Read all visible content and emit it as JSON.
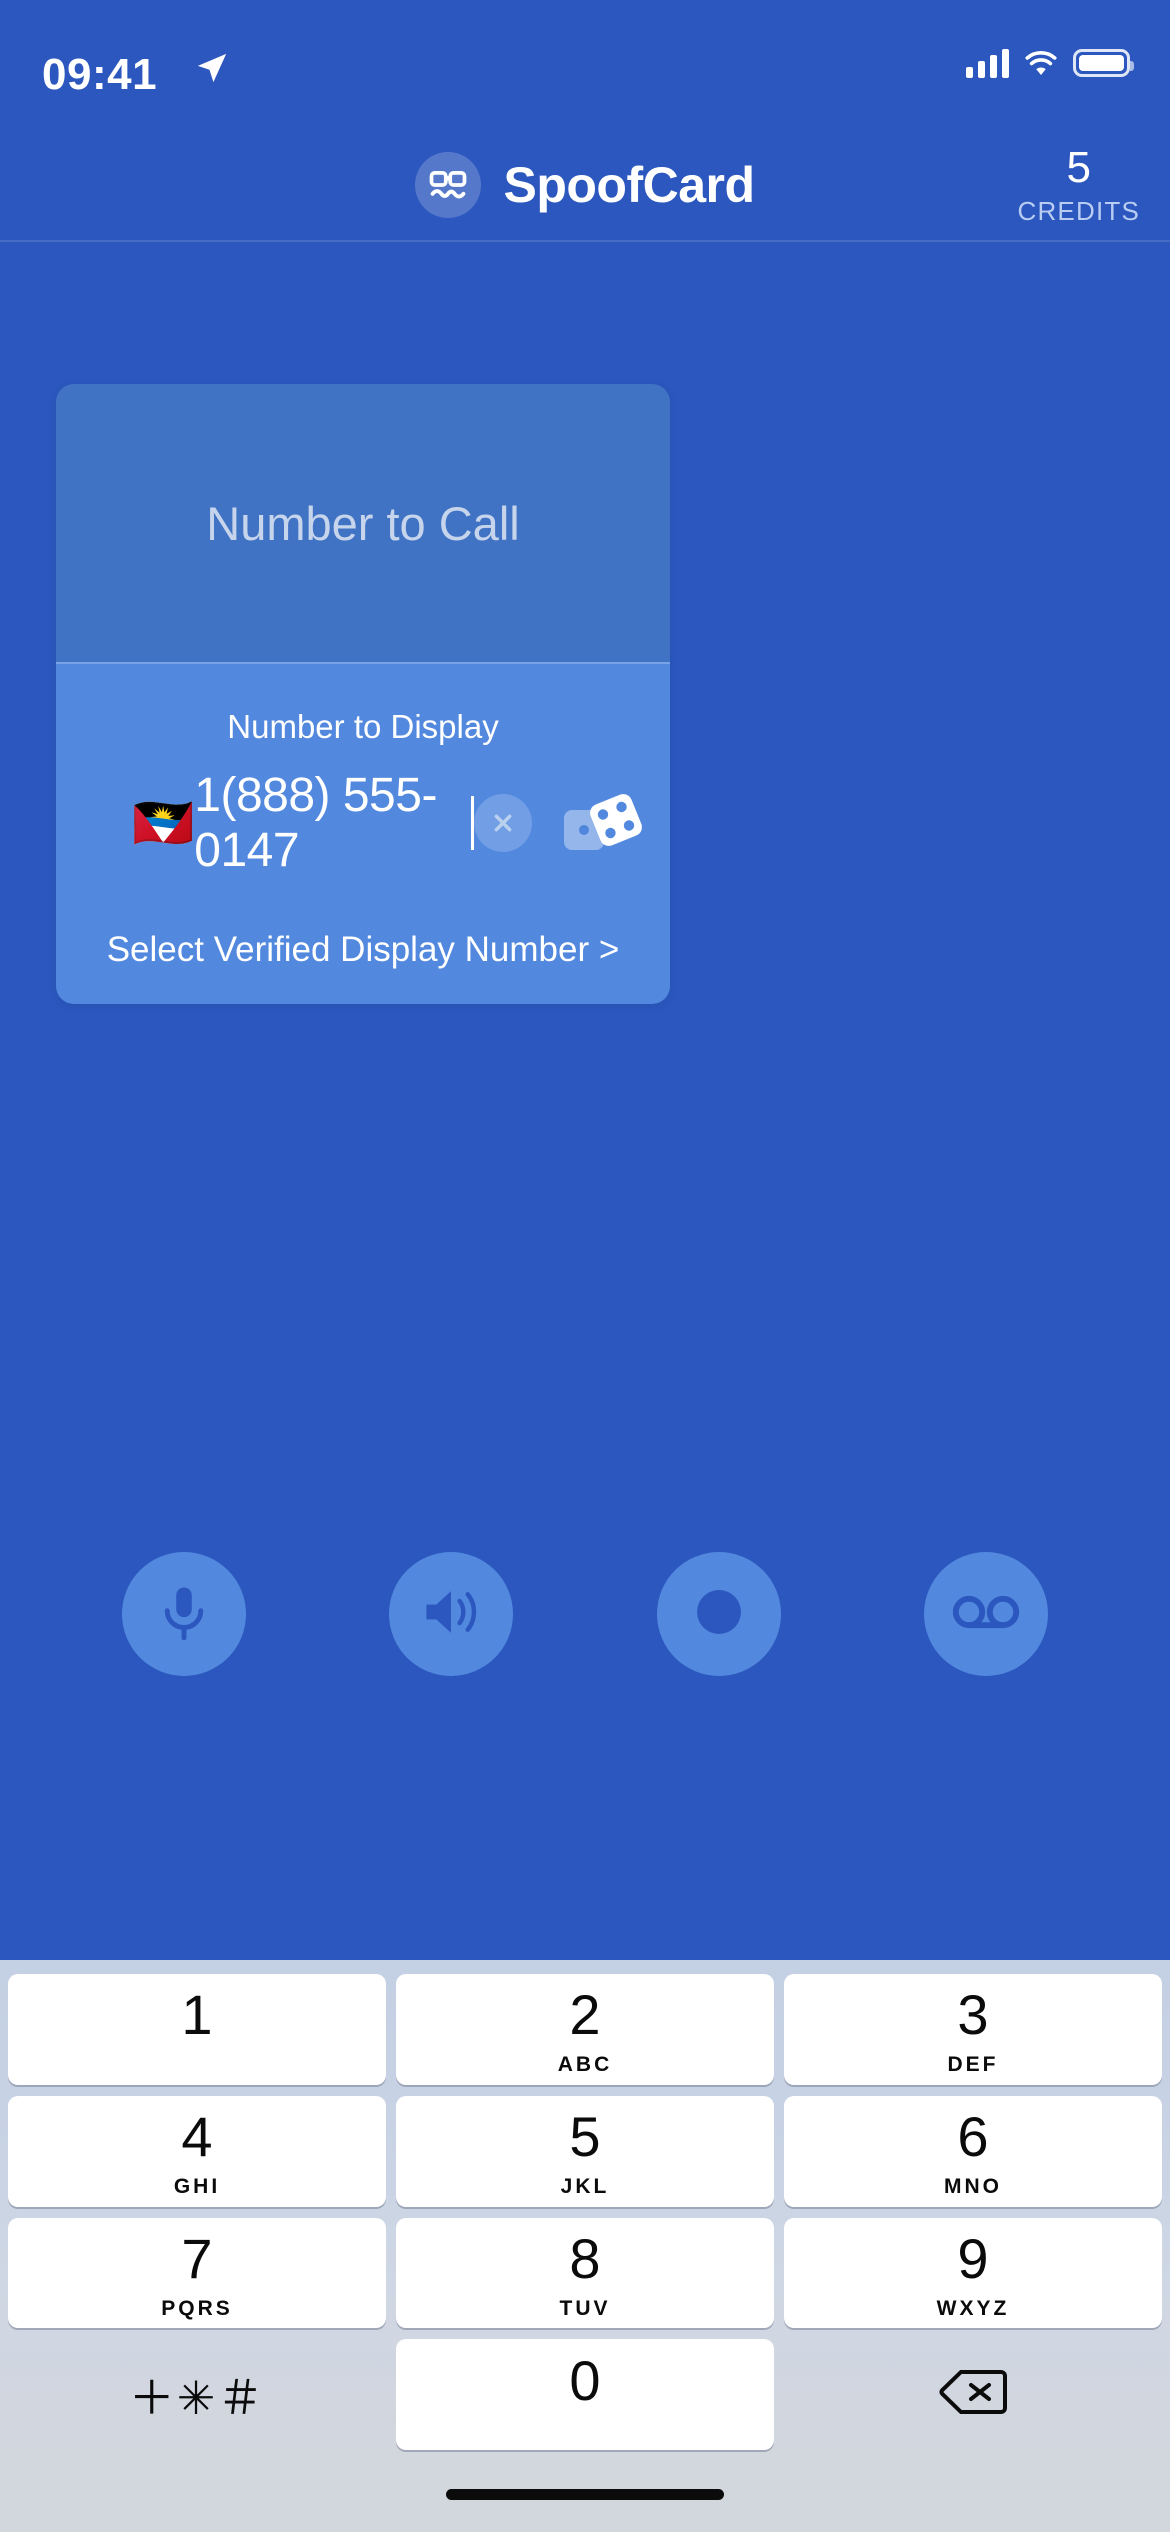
{
  "status_bar": {
    "time": "09:41",
    "location_icon": "location-arrow-icon",
    "signal_icon": "cellular-signal-icon",
    "wifi_icon": "wifi-icon",
    "battery_icon": "battery-full-icon"
  },
  "header": {
    "logo_icon": "spoofcard-mask-logo-icon",
    "app_name": "SpoofCard",
    "credits_count": "5",
    "credits_label": "CREDITS"
  },
  "dial_card": {
    "call_field": {
      "placeholder": "Number to Call",
      "value": ""
    },
    "display_field": {
      "label": "Number to Display",
      "flag": "🇦🇬",
      "value": "1(888) 555-0147",
      "clear_icon": "clear-circle-x-icon",
      "random_icon": "dice-icon"
    },
    "select_verified_label": "Select Verified Display Number >"
  },
  "actions": [
    {
      "name": "voice-changer",
      "icon": "microphone-icon"
    },
    {
      "name": "sound-effects",
      "icon": "speaker-waves-icon"
    },
    {
      "name": "call-recording",
      "icon": "record-circle-icon"
    },
    {
      "name": "straight-to-voicemail",
      "icon": "voicemail-icon"
    }
  ],
  "keypad": {
    "rows": [
      [
        {
          "digit": "1",
          "letters": ""
        },
        {
          "digit": "2",
          "letters": "ABC"
        },
        {
          "digit": "3",
          "letters": "DEF"
        }
      ],
      [
        {
          "digit": "4",
          "letters": "GHI"
        },
        {
          "digit": "5",
          "letters": "JKL"
        },
        {
          "digit": "6",
          "letters": "MNO"
        }
      ],
      [
        {
          "digit": "7",
          "letters": "PQRS"
        },
        {
          "digit": "8",
          "letters": "TUV"
        },
        {
          "digit": "9",
          "letters": "WXYZ"
        }
      ]
    ],
    "symbols_key": "＋✳＃",
    "zero_key": {
      "digit": "0",
      "letters": ""
    },
    "backspace_icon": "backspace-delete-icon"
  },
  "colors": {
    "app_background": "#2B57BE",
    "card_top": "#4073C4",
    "card_bottom": "#5289DF",
    "accent_text": "#FFFFFF",
    "muted_text": "#C6D4EC",
    "credits_label": "#B9CDF2",
    "keyboard_background": "#CAD3E3",
    "key_face": "#FFFFFF",
    "key_text": "#0B0B0B"
  }
}
